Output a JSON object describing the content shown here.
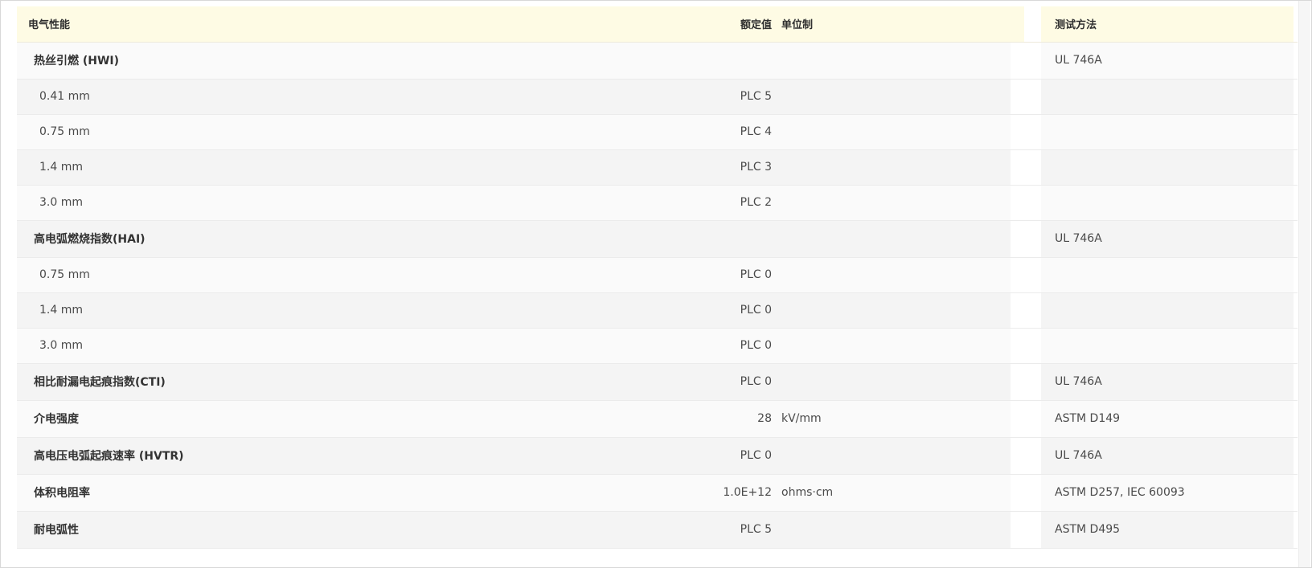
{
  "table": {
    "headers": {
      "property": "电气性能",
      "rated_value": "额定值",
      "unit": "单位制",
      "test_method": "测试方法"
    },
    "rows": [
      {
        "type": "group",
        "name": "热丝引燃 (HWI)",
        "value": "",
        "unit": "",
        "method": "UL 746A"
      },
      {
        "type": "sub",
        "name": "0.41 mm",
        "value": "PLC 5",
        "unit": "",
        "method": ""
      },
      {
        "type": "sub",
        "name": "0.75 mm",
        "value": "PLC 4",
        "unit": "",
        "method": ""
      },
      {
        "type": "sub",
        "name": "1.4 mm",
        "value": "PLC 3",
        "unit": "",
        "method": ""
      },
      {
        "type": "sub",
        "name": "3.0 mm",
        "value": "PLC 2",
        "unit": "",
        "method": ""
      },
      {
        "type": "group",
        "name": "高电弧燃烧指数(HAI)",
        "value": "",
        "unit": "",
        "method": "UL 746A"
      },
      {
        "type": "sub",
        "name": "0.75 mm",
        "value": "PLC 0",
        "unit": "",
        "method": ""
      },
      {
        "type": "sub",
        "name": "1.4 mm",
        "value": "PLC 0",
        "unit": "",
        "method": ""
      },
      {
        "type": "sub",
        "name": "3.0 mm",
        "value": "PLC 0",
        "unit": "",
        "method": ""
      },
      {
        "type": "group",
        "name": "相比耐漏电起痕指数(CTI)",
        "value": "PLC 0",
        "unit": "",
        "method": "UL 746A"
      },
      {
        "type": "group",
        "name": "介电强度",
        "value": "28",
        "unit": "kV/mm",
        "method": "ASTM D149"
      },
      {
        "type": "group",
        "name": "高电压电弧起痕速率 (HVTR)",
        "value": "PLC 0",
        "unit": "",
        "method": "UL 746A"
      },
      {
        "type": "group",
        "name": "体积电阻率",
        "value": "1.0E+12",
        "unit": "ohms·cm",
        "method": "ASTM D257, IEC 60093"
      },
      {
        "type": "group",
        "name": "耐电弧性",
        "value": "PLC 5",
        "unit": "",
        "method": "ASTM D495"
      }
    ]
  },
  "colors": {
    "header_bg": "#fefbe4",
    "row_odd": "#fafafa",
    "row_even": "#f4f4f4"
  }
}
